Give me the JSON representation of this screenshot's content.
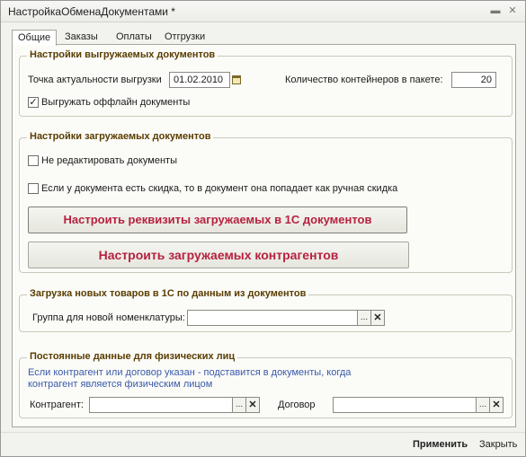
{
  "window": {
    "title": "НастройкаОбменаДокументами *",
    "minimize_glyph": "▬",
    "close_glyph": "✕"
  },
  "tabs": [
    {
      "label": "Общие",
      "active": true
    },
    {
      "label": "Заказы",
      "active": false
    },
    {
      "label": "Оплаты",
      "active": false
    },
    {
      "label": "Отгрузки",
      "active": false
    }
  ],
  "export_settings": {
    "title": "Настройки выгружаемых документов",
    "date_label": "Точка актуальности выгрузки",
    "date_value": "01.02.2010",
    "containers_label": "Количество контейнеров в пакете:",
    "containers_value": "20",
    "offline_label": "Выгружать оффлайн документы",
    "offline_checked": true
  },
  "import_settings": {
    "title": "Настройки загружаемых документов",
    "no_edit_label": "Не редактировать документы",
    "no_edit_checked": false,
    "discount_label": "Если у документа есть скидка, то в документ она попадает как ручная скидка",
    "discount_checked": false,
    "btn_requisites": "Настроить реквизиты загружаемых в 1С документов",
    "btn_counterparties": "Настроить загружаемых контрагентов"
  },
  "new_goods": {
    "title": "Загрузка новых товаров в 1С по данным из документов",
    "group_label": "Группа для новой номенклатуры:",
    "group_value": ""
  },
  "individuals": {
    "title": "Постоянные данные для физических лиц",
    "hint": "Если контрагент или договор указан - подставится в документы, когда контрагент является физическим лицом",
    "counterparty_label": "Контрагент:",
    "counterparty_value": "",
    "contract_label": "Договор",
    "contract_value": ""
  },
  "glyphs": {
    "check": "✓",
    "select": "...",
    "clear": "✕"
  },
  "footer": {
    "apply": "Применить",
    "close": "Закрыть"
  },
  "colors": {
    "group_title": "#5a3d00",
    "button_text": "#b7223f",
    "hint_text": "#3a5aa8"
  }
}
